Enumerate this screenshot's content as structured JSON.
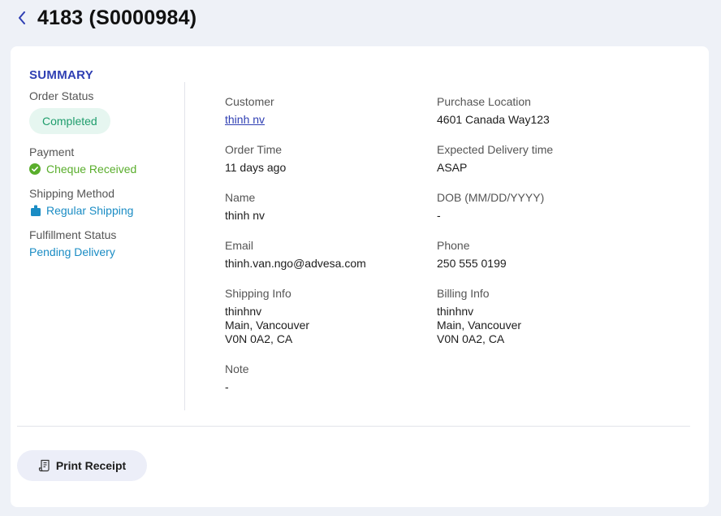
{
  "header": {
    "title": "4183 (S0000984)"
  },
  "summary": {
    "title": "SUMMARY",
    "order_status_label": "Order Status",
    "order_status_value": "Completed",
    "payment_label": "Payment",
    "payment_value": "Cheque Received",
    "shipping_method_label": "Shipping Method",
    "shipping_method_value": "Regular Shipping",
    "fulfillment_label": "Fulfillment Status",
    "fulfillment_value": "Pending Delivery"
  },
  "details": {
    "customer_label": "Customer",
    "customer_value": "thinh nv",
    "purchase_location_label": "Purchase Location",
    "purchase_location_value": "4601 Canada Way123",
    "order_time_label": "Order Time",
    "order_time_value": "11 days ago",
    "expected_delivery_label": "Expected Delivery time",
    "expected_delivery_value": "ASAP",
    "name_label": "Name",
    "name_value": "thinh nv",
    "dob_label": "DOB (MM/DD/YYYY)",
    "dob_value": "-",
    "email_label": "Email",
    "email_value": "thinh.van.ngo@advesa.com",
    "phone_label": "Phone",
    "phone_value": "250 555 0199",
    "shipping_info_label": "Shipping Info",
    "shipping_info_lines": [
      "thinhnv",
      "Main, Vancouver",
      "V0N 0A2, CA"
    ],
    "billing_info_label": "Billing Info",
    "billing_info_lines": [
      "thinhnv",
      "Main, Vancouver",
      "V0N 0A2, CA"
    ],
    "note_label": "Note",
    "note_value": "-"
  },
  "actions": {
    "print_label": "Print Receipt"
  },
  "colors": {
    "accent": "#2f3fb3",
    "success": "#5aae2c",
    "link_blue": "#1a8cc4",
    "badge_bg": "#e6f6f0",
    "badge_text": "#1f9d6c"
  }
}
